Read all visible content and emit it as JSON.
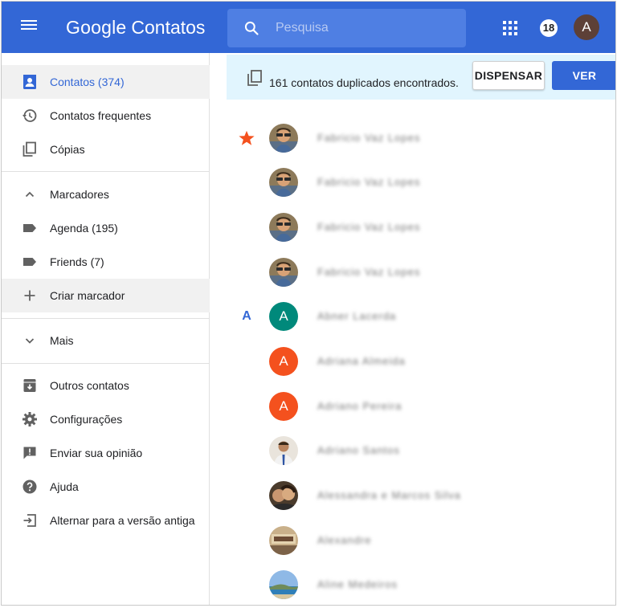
{
  "header": {
    "logo_google": "Google",
    "logo_product": "Contatos",
    "search_placeholder": "Pesquisa",
    "notification_count": "18",
    "account_initial": "A",
    "brand_color": "#3367d6"
  },
  "sidebar": {
    "items": [
      {
        "label": "Contatos (374)",
        "icon": "contacts-icon",
        "active": true
      },
      {
        "label": "Contatos frequentes",
        "icon": "history-icon"
      },
      {
        "label": "Cópias",
        "icon": "copy-icon"
      },
      {
        "label": "Marcadores",
        "icon": "chevron-up-icon"
      },
      {
        "label": "Agenda (195)",
        "icon": "label-icon"
      },
      {
        "label": "Friends (7)",
        "icon": "label-icon"
      },
      {
        "label": "Criar marcador",
        "icon": "plus-icon"
      },
      {
        "label": "Mais",
        "icon": "chevron-down-icon"
      },
      {
        "label": "Outros contatos",
        "icon": "archive-icon"
      },
      {
        "label": "Configurações",
        "icon": "gear-icon"
      },
      {
        "label": "Enviar sua opinião",
        "icon": "feedback-icon"
      },
      {
        "label": "Ajuda",
        "icon": "help-icon"
      },
      {
        "label": "Alternar para a versão antiga",
        "icon": "exit-icon"
      }
    ]
  },
  "banner": {
    "text": "161 contatos duplicados encontrados.",
    "dismiss_label": "DISPENSAR",
    "view_label": "VER"
  },
  "contacts": [
    {
      "marker": "star",
      "avatar": "photo-selfie",
      "name": "Fabricio Vaz Lopes"
    },
    {
      "marker": "",
      "avatar": "photo-selfie",
      "name": "Fabricio Vaz Lopes"
    },
    {
      "marker": "",
      "avatar": "photo-selfie",
      "name": "Fabricio Vaz Lopes"
    },
    {
      "marker": "",
      "avatar": "photo-selfie",
      "name": "Fabricio Vaz Lopes"
    },
    {
      "marker": "A",
      "avatar": "A",
      "avatar_color": "#00897b",
      "name": "Abner Lacerda"
    },
    {
      "marker": "",
      "avatar": "A",
      "avatar_color": "#f4511e",
      "name": "Adriana Almeida"
    },
    {
      "marker": "",
      "avatar": "A",
      "avatar_color": "#f4511e",
      "name": "Adriano Pereira"
    },
    {
      "marker": "",
      "avatar": "photo-man-tie",
      "name": "Adriano Santos"
    },
    {
      "marker": "",
      "avatar": "photo-couple",
      "name": "Alessandra e Marcos Silva"
    },
    {
      "marker": "",
      "avatar": "photo-sign",
      "name": "Alexandre"
    },
    {
      "marker": "",
      "avatar": "photo-beach",
      "name": "Aline Medeiros"
    }
  ]
}
